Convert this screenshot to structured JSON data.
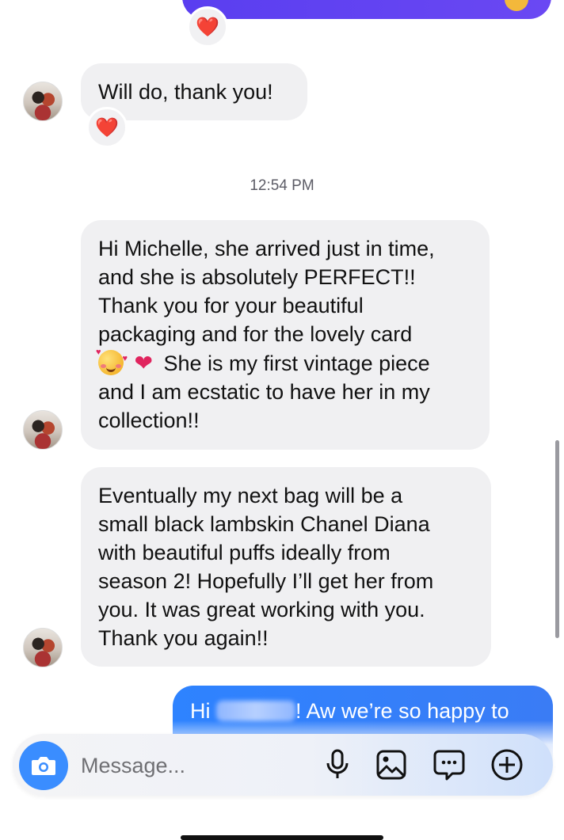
{
  "thread": {
    "messages": [
      {
        "text": "Will do, thank you!",
        "reaction": "❤️"
      },
      {
        "text": "Hi Michelle, she arrived just in time,\nand she is absolutely PERFECT!!\nThank you for your beautiful\npackaging and for the lovely card",
        "text_line2": "She is my first vintage piece\nand I am ecstatic to have her in my\ncollection!!"
      },
      {
        "text": "Eventually my next bag will be a\nsmall black lambskin Chanel Diana\nwith beautiful puffs ideally from\nseason 2! Hopefully I’ll get her from\nyou. It was great working with you.\nThank you again!!"
      }
    ],
    "timestamp": "12:54 PM",
    "top_reaction": "❤️",
    "outgoing_partial": {
      "prefix": "Hi",
      "suffix": "! Aw we’re so happy to"
    }
  },
  "composer": {
    "placeholder": "Message..."
  },
  "colors": {
    "outgoing_bubble": "#3a7cf5",
    "incoming_bubble": "#f0f0f2",
    "camera_button": "#3a8dff"
  },
  "icons": [
    "camera-icon",
    "microphone-icon",
    "gallery-icon",
    "sticker-icon",
    "add-icon",
    "heart-icon"
  ]
}
